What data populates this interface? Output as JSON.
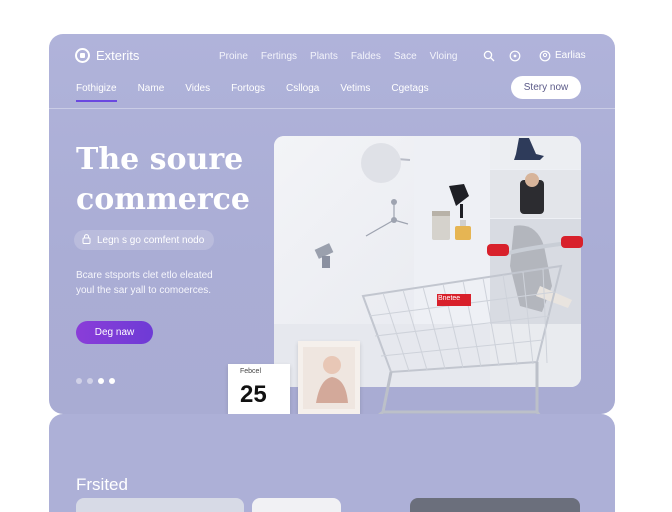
{
  "brand": {
    "name": "Exterits"
  },
  "top_nav": {
    "links": [
      "Proine",
      "Fertings",
      "Plants",
      "Faldes",
      "Sace",
      "Vloing"
    ]
  },
  "account": {
    "label": "Earlias"
  },
  "sub_nav": {
    "items": [
      "Fothigize",
      "Name",
      "Vides",
      "Fortogs",
      "Cslloga",
      "Vetims",
      "Cgetags"
    ],
    "active_index": 0
  },
  "store_button": {
    "label": "Stery now"
  },
  "hero": {
    "title_line1": "The soure",
    "title_line2": "commerce",
    "chip_label": "Legn s go comfent nodo",
    "description_line1": "Bcare stsports clet etlo eleated",
    "description_line2": "youl the sar yall to comoerces.",
    "cta_label": "Deg naw",
    "slides": {
      "count": 4,
      "active_index": 2
    }
  },
  "calendar": {
    "month": "Febcel",
    "day": "25"
  },
  "cart_tag": {
    "text": "Bnetee"
  },
  "featured": {
    "title": "Frsited"
  },
  "colors": {
    "hero_bg": "#acafd6",
    "cta": "#7a3bdc",
    "accent_underline": "#6a48e0",
    "cart_handle": "#d8202b"
  },
  "icons": [
    "search-icon",
    "circle-icon",
    "user-icon",
    "shopping-cart"
  ]
}
